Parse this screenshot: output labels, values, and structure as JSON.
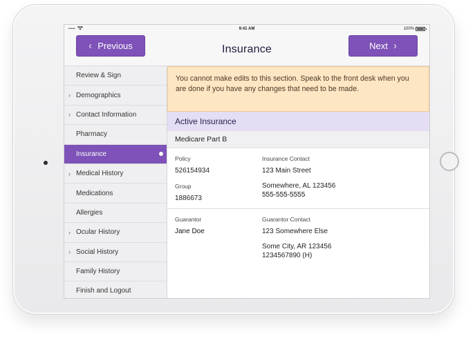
{
  "status_bar": {
    "carrier": "•••••",
    "wifi_icon": "wifi-icon",
    "time": "9:41 AM",
    "battery": "100%"
  },
  "nav": {
    "title": "Insurance",
    "previous_label": "Previous",
    "next_label": "Next"
  },
  "sidebar": {
    "items": [
      {
        "label": "Review & Sign",
        "expandable": false,
        "active": false
      },
      {
        "label": "Demographics",
        "expandable": true,
        "active": false
      },
      {
        "label": "Contact Information",
        "expandable": true,
        "active": false
      },
      {
        "label": "Pharmacy",
        "expandable": false,
        "active": false
      },
      {
        "label": "Insurance",
        "expandable": false,
        "active": true
      },
      {
        "label": "Medical History",
        "expandable": true,
        "active": false
      },
      {
        "label": "Medications",
        "expandable": false,
        "active": false
      },
      {
        "label": "Allergies",
        "expandable": false,
        "active": false
      },
      {
        "label": "Ocular History",
        "expandable": true,
        "active": false
      },
      {
        "label": "Social History",
        "expandable": true,
        "active": false
      },
      {
        "label": "Family History",
        "expandable": false,
        "active": false
      },
      {
        "label": "Finish and Logout",
        "expandable": false,
        "active": false
      }
    ]
  },
  "notice": {
    "text": "You cannot make edits to this section. Speak to the front desk when you are done if you have any changes that need to be made."
  },
  "insurance": {
    "section_title": "Active Insurance",
    "plan_name": "Medicare Part B",
    "policy_label": "Policy",
    "policy_value": "526154934",
    "group_label": "Group",
    "group_value": "1886673",
    "contact_label": "Insurance Contact",
    "contact_street": "123 Main Street",
    "contact_city": "Somewhere, AL 123456",
    "contact_phone": "555-555-5555"
  },
  "guarantor": {
    "label": "Guarantor",
    "name": "Jane Doe",
    "contact_label": "Guarantor Contact",
    "street": "123 Somewhere Else",
    "city": "Some City, AR 123456",
    "phone": "1234567890 (H)"
  },
  "colors": {
    "accent": "#7e52b8",
    "notice_bg": "#fde6c4",
    "section_bg": "#e4ddf4",
    "sidebar_bg": "#efeff1"
  }
}
